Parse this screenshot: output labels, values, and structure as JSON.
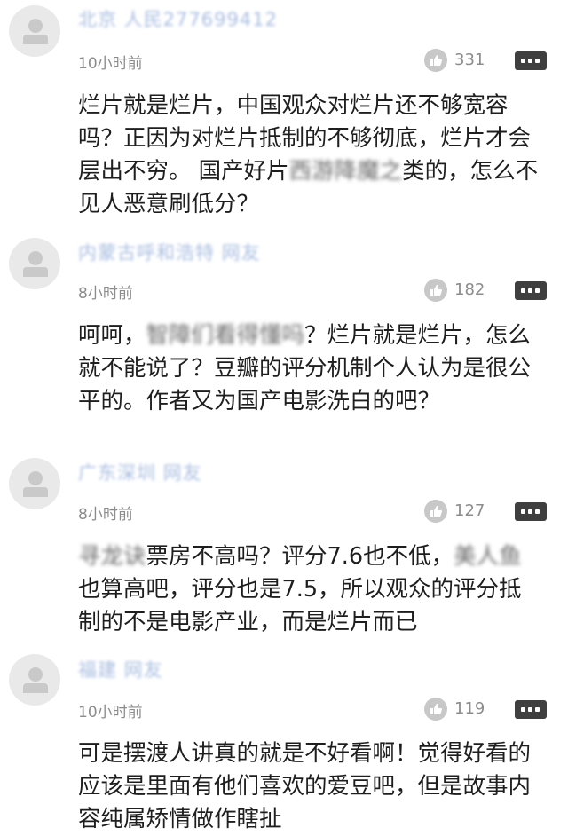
{
  "comments": [
    {
      "author": "北京 人民277699412",
      "time": "10小时前",
      "likes": "331",
      "text_before": "烂片就是烂片，中国观众对烂片还不够宽容吗？正因为对烂片抵制的不够彻底，烂片才会层出不穷。 国产好片",
      "text_blurred": "西游降魔之",
      "text_after": "类的，怎么不见人恶意刷低分？"
    },
    {
      "author": "内蒙古呼和浩特 网友",
      "time": "8小时前",
      "likes": "182",
      "text_before": "呵呵，",
      "text_blurred": "智障们看得懂吗",
      "text_after": "？烂片就是烂片，怎么就不能说了？豆瓣的评分机制个人认为是很公平的。作者又为国产电影洗白的吧？"
    },
    {
      "author": "广东深圳 网友",
      "time": "8小时前",
      "likes": "127",
      "text_blurred_1": "寻龙诀",
      "text_before": "票房不高吗？评分7.6也不低，",
      "text_blurred_2": "美人鱼",
      "text_middle": "也算高吧，评分也是7.5，所以观众的评分抵制的不是电影产业，而是烂片而已"
    },
    {
      "author": "福建 网友",
      "time": "10小时前",
      "likes": "119",
      "text": "可是摆渡人讲真的就是不好看啊！觉得好看的应该是里面有他们喜欢的爱豆吧，但是故事内容纯属矫情做作瞎扯"
    }
  ],
  "icons": {
    "avatar": "avatar-icon",
    "like": "thumbs-up-icon",
    "more": "more-icon"
  },
  "colors": {
    "author": "#a8bde0",
    "meta": "#8c8c8c",
    "like_bg": "#c8c8c8",
    "more_bg": "#3f3f3f"
  }
}
